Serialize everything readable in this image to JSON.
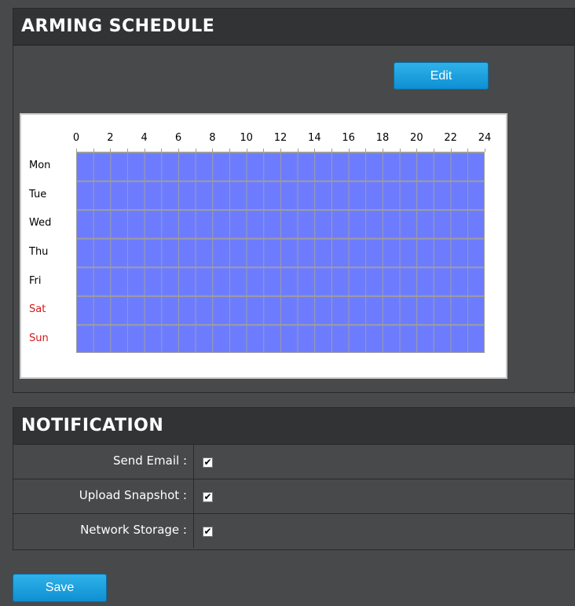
{
  "arming": {
    "title": "ARMING SCHEDULE",
    "edit_label": "Edit",
    "hours": [
      "0",
      "2",
      "4",
      "6",
      "8",
      "10",
      "12",
      "14",
      "16",
      "18",
      "20",
      "22",
      "24"
    ],
    "days": [
      {
        "label": "Mon",
        "weekend": false
      },
      {
        "label": "Tue",
        "weekend": false
      },
      {
        "label": "Wed",
        "weekend": false
      },
      {
        "label": "Thu",
        "weekend": false
      },
      {
        "label": "Fri",
        "weekend": false
      },
      {
        "label": "Sat",
        "weekend": true
      },
      {
        "label": "Sun",
        "weekend": true
      }
    ],
    "schedule_fill_color": "#6d7cff",
    "weekend_color": "#d51818"
  },
  "notification": {
    "title": "NOTIFICATION",
    "rows": [
      {
        "label": "Send Email :",
        "checked": true
      },
      {
        "label": "Upload Snapshot :",
        "checked": true
      },
      {
        "label": "Network Storage :",
        "checked": true
      }
    ]
  },
  "footer": {
    "save_label": "Save"
  },
  "colors": {
    "accent": "#1a9de0",
    "panel_bg": "#48494b",
    "header_bg": "#323335"
  }
}
